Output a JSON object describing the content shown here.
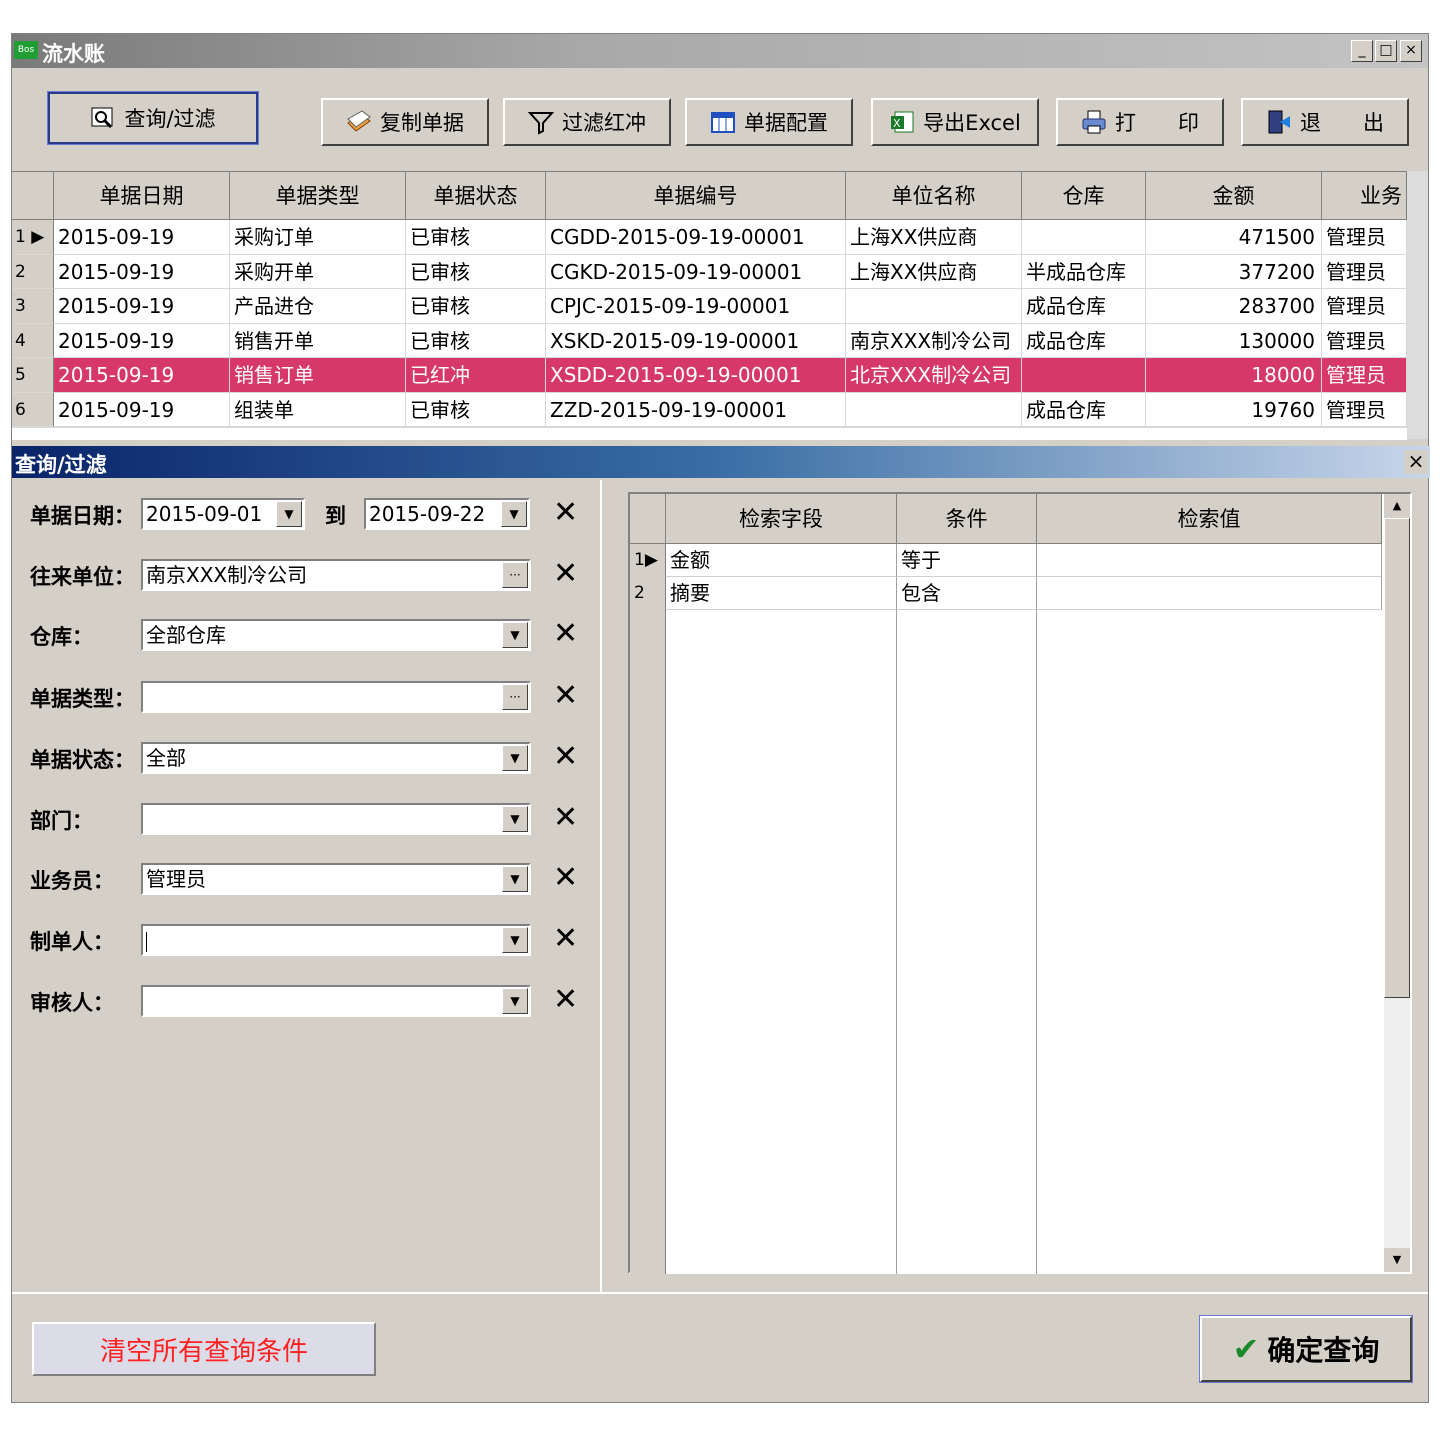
{
  "window": {
    "title": "流水账",
    "app_icon": "Bos",
    "buttons": [
      "_",
      "□",
      "×"
    ]
  },
  "toolbar": {
    "query": "查询/过滤",
    "copy": "复制单据",
    "filter_red": "过滤红冲",
    "config": "单据配置",
    "export": "导出Excel",
    "print": "打　　印",
    "exit": "退　　出"
  },
  "grid": {
    "columns": [
      "单据日期",
      "单据类型",
      "单据状态",
      "单据编号",
      "单位名称",
      "仓库",
      "金额",
      "业务"
    ],
    "rows": [
      {
        "n": "1",
        "date": "2015-09-19",
        "type": "采购订单",
        "status": "已审核",
        "code": "CGDD-2015-09-19-00001",
        "unit": "上海XX供应商",
        "wh": "",
        "amount": "471500",
        "staff": "管理员"
      },
      {
        "n": "2",
        "date": "2015-09-19",
        "type": "采购开单",
        "status": "已审核",
        "code": "CGKD-2015-09-19-00001",
        "unit": "上海XX供应商",
        "wh": "半成品仓库",
        "amount": "377200",
        "staff": "管理员"
      },
      {
        "n": "3",
        "date": "2015-09-19",
        "type": "产品进仓",
        "status": "已审核",
        "code": "CPJC-2015-09-19-00001",
        "unit": "",
        "wh": "成品仓库",
        "amount": "283700",
        "staff": "管理员"
      },
      {
        "n": "4",
        "date": "2015-09-19",
        "type": "销售开单",
        "status": "已审核",
        "code": "XSKD-2015-09-19-00001",
        "unit": "南京XXX制冷公司",
        "wh": "成品仓库",
        "amount": "130000",
        "staff": "管理员"
      },
      {
        "n": "5",
        "date": "2015-09-19",
        "type": "销售订单",
        "status": "已红冲",
        "code": "XSDD-2015-09-19-00001",
        "unit": "北京XXX制冷公司",
        "wh": "",
        "amount": "18000",
        "staff": "管理员"
      },
      {
        "n": "6",
        "date": "2015-09-19",
        "type": "组装单",
        "status": "已审核",
        "code": "ZZD-2015-09-19-00001",
        "unit": "",
        "wh": "成品仓库",
        "amount": "19760",
        "staff": "管理员"
      }
    ],
    "selected_color": "#d6386a"
  },
  "panel": {
    "title": "查询/过滤",
    "date_label": "单据日期：",
    "date_from": "2015-09-01",
    "to_label": "到",
    "date_to": "2015-09-22",
    "partner_label": "往来单位：",
    "partner": "南京XXX制冷公司",
    "warehouse_label": "仓库：",
    "warehouse": "全部仓库",
    "doc_type_label": "单据类型：",
    "doc_type": "",
    "doc_status_label": "单据状态：",
    "doc_status": "全部",
    "dept_label": "部门：",
    "dept": "",
    "salesman_label": "业务员：",
    "salesman": "管理员",
    "maker_label": "制单人：",
    "maker": "",
    "auditor_label": "审核人：",
    "auditor": "",
    "search_grid": {
      "columns": [
        "检索字段",
        "条件",
        "检索值"
      ],
      "rows": [
        {
          "n": "1",
          "field": "金额",
          "cond": "等于",
          "value": ""
        },
        {
          "n": "2",
          "field": "摘要",
          "cond": "包含",
          "value": ""
        }
      ]
    },
    "clear_button": "清空所有查询条件",
    "confirm_button": "确定查询",
    "clear_color": "#ff2020"
  }
}
